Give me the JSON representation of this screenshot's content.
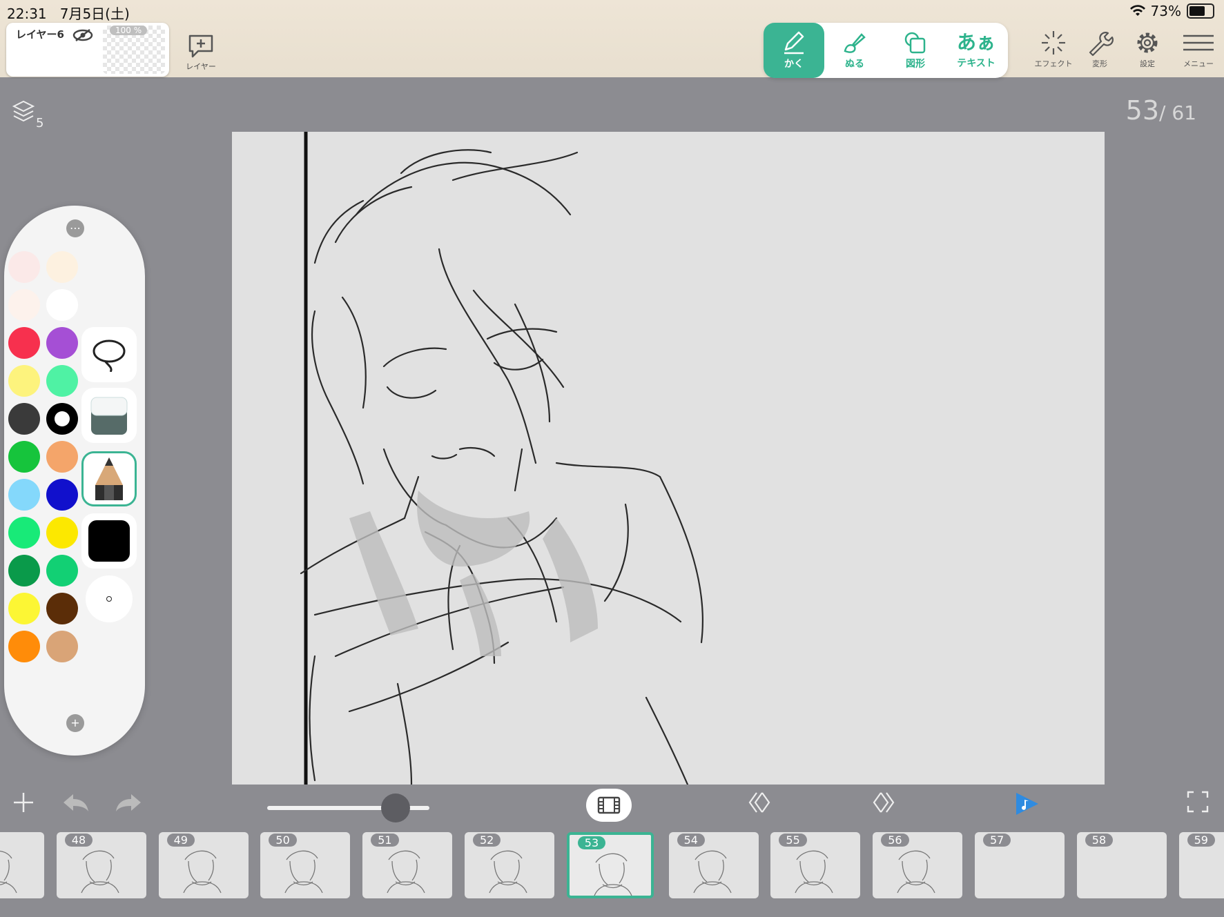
{
  "status": {
    "time": "22:31",
    "date": "7月5日(土)",
    "battery": "73%",
    "battery_level": 0.73
  },
  "layer_card": {
    "name": "レイヤー6",
    "opacity": "100 %"
  },
  "add_layer": {
    "label": "レイヤー"
  },
  "tools": [
    {
      "label": "かく",
      "active": true
    },
    {
      "label": "ぬる"
    },
    {
      "label": "図形"
    },
    {
      "label": "テキスト",
      "glyph": "あぁ"
    }
  ],
  "right_buttons": {
    "effect": "エフェクト",
    "transform": "変形",
    "settings": "設定",
    "menu": "メニュー"
  },
  "layers_count": "5",
  "page": {
    "current": "53",
    "total": "/ 61"
  },
  "palette_colors": [
    [
      "#fbe9e8",
      "#fdf1e0"
    ],
    [
      "#fdf2ec",
      "#ffffff"
    ],
    [
      "#f7304e",
      "#a54fd5"
    ],
    [
      "#fdf37d",
      "#4ff2a4"
    ],
    [
      "#3a3a3a",
      "#000000"
    ],
    [
      "#16c43c",
      "#f4a56a"
    ],
    [
      "#84d8fb",
      "#1110cc"
    ],
    [
      "#18ea78",
      "#fce800"
    ],
    [
      "#0a9a4a",
      "#12d074"
    ],
    [
      "#fcf634",
      "#5b2d08"
    ],
    [
      "#ff8c09",
      "#d9a477"
    ]
  ],
  "palette_tools": [
    "lasso",
    "eraser",
    "pencil",
    "color-black",
    "brush-size"
  ],
  "frames": [
    "",
    "48",
    "49",
    "50",
    "51",
    "52",
    "53",
    "54",
    "55",
    "56",
    "57",
    "58",
    "59"
  ],
  "current_frame": "53",
  "accent": "#3bb493"
}
